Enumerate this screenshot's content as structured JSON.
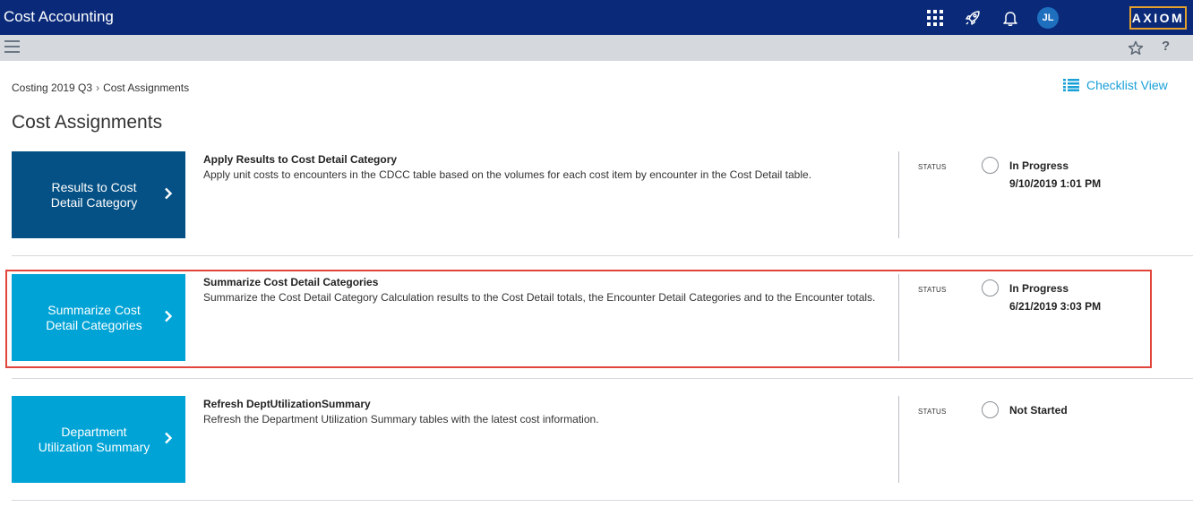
{
  "app": {
    "title": "Cost Accounting",
    "user_initials": "JL",
    "logo_text": "AXIOM",
    "colors": {
      "topbar": "#0a2a79",
      "accent": "#1aa0d8",
      "highlight": "#e0443a"
    },
    "icons": [
      "apps-grid-icon",
      "rocket-icon",
      "bell-icon",
      "menu-icon",
      "star-icon",
      "help-icon"
    ]
  },
  "subbar": {
    "help_label": "?"
  },
  "breadcrumb": {
    "items": [
      "Costing 2019 Q3",
      "Cost Assignments"
    ],
    "separator": "›"
  },
  "checklist_view_label": "Checklist View",
  "page_title": "Cost Assignments",
  "status_label": "STATUS",
  "tasks": [
    {
      "tile_label_line1": "Results to Cost",
      "tile_label_line2": "Detail Category",
      "title": "Apply Results to Cost Detail Category",
      "description": "Apply unit costs to encounters in the CDCC table based on the volumes for each cost item by encounter in the Cost Detail table.",
      "status": "In Progress",
      "date": "9/10/2019 1:01 PM"
    },
    {
      "tile_label_line1": "Summarize Cost",
      "tile_label_line2": "Detail Categories",
      "title": "Summarize Cost Detail Categories",
      "description": "Summarize the Cost Detail Category Calculation results to the Cost Detail totals, the Encounter Detail Categories and to the Encounter totals.",
      "status": "In Progress",
      "date": "6/21/2019 3:03 PM"
    },
    {
      "tile_label_line1": "Department",
      "tile_label_line2": "Utilization Summary",
      "title": "Refresh DeptUtilizationSummary",
      "description": "Refresh the Department Utilization Summary tables with the latest cost information.",
      "status": "Not Started",
      "date": ""
    }
  ]
}
